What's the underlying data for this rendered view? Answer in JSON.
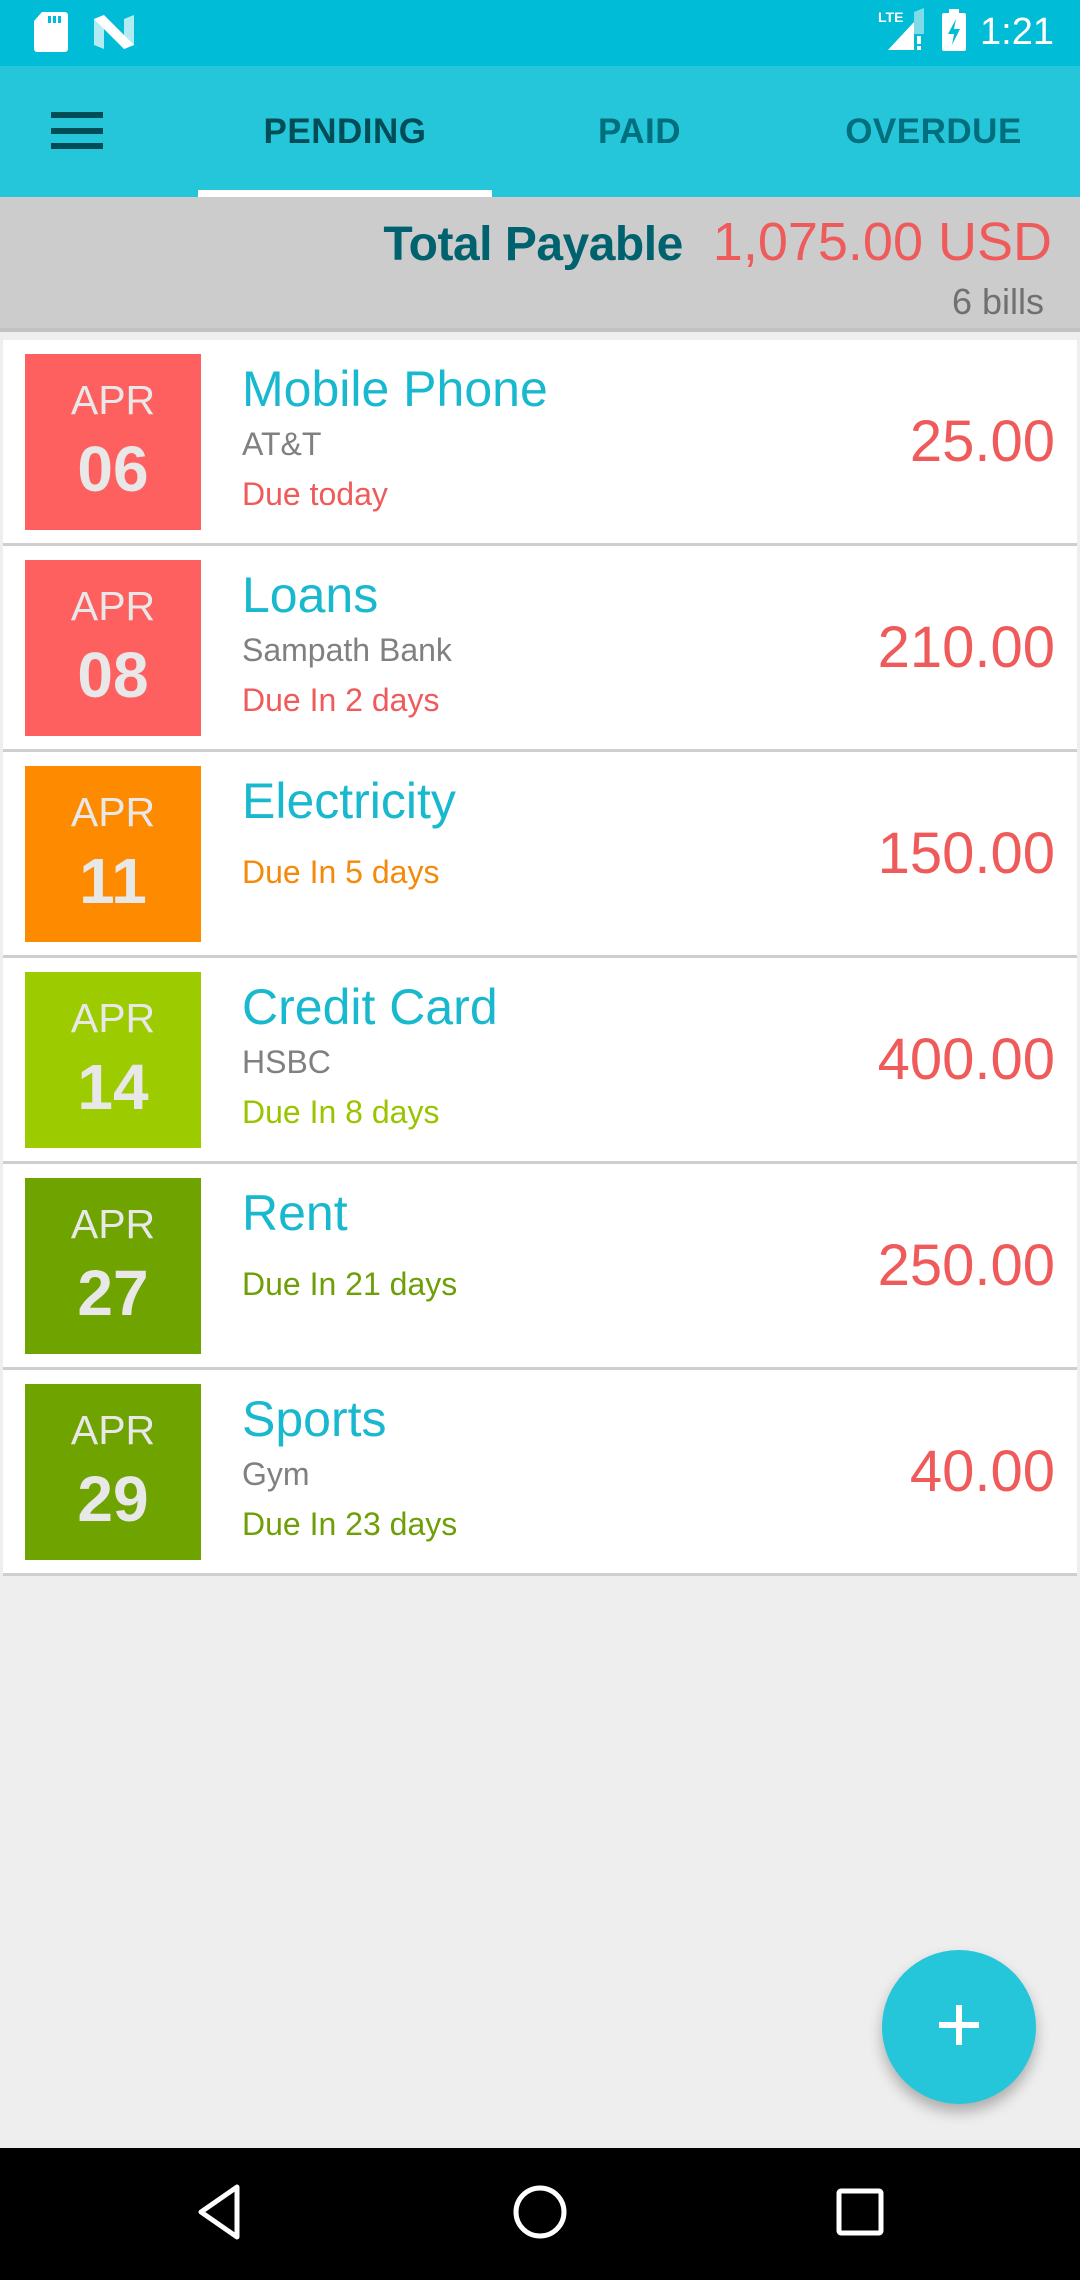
{
  "status_bar": {
    "time": "1:21",
    "icons": [
      "sd-card-icon",
      "android-n-icon",
      "lte-signal-icon",
      "battery-charging-icon"
    ],
    "network_label": "LTE"
  },
  "toolbar": {
    "menu_icon": "hamburger-menu-icon",
    "tabs": [
      {
        "label": "PENDING",
        "active": true
      },
      {
        "label": "PAID",
        "active": false
      },
      {
        "label": "OVERDUE",
        "active": false
      }
    ]
  },
  "summary": {
    "total_label": "Total Payable",
    "total_value": "1,075.00 USD",
    "bill_count": "6 bills"
  },
  "bills": [
    {
      "month": "APR",
      "day": "06",
      "name": "Mobile Phone",
      "payee": "AT&T",
      "due": "Due today",
      "amount": "25.00",
      "color": "#fe6060",
      "due_color": "#ef5a5a"
    },
    {
      "month": "APR",
      "day": "08",
      "name": "Loans",
      "payee": "Sampath Bank",
      "due": "Due In 2 days",
      "amount": "210.00",
      "color": "#fe6060",
      "due_color": "#ef5a5a"
    },
    {
      "month": "APR",
      "day": "11",
      "name": "Electricity",
      "payee": "",
      "due": "Due In 5 days",
      "amount": "150.00",
      "color": "#fe8a00",
      "due_color": "#f58a0a"
    },
    {
      "month": "APR",
      "day": "14",
      "name": "Credit Card",
      "payee": "HSBC",
      "due": "Due In 8 days",
      "amount": "400.00",
      "color": "#9ccc00",
      "due_color": "#9ac400"
    },
    {
      "month": "APR",
      "day": "27",
      "name": "Rent",
      "payee": "",
      "due": "Due In 21 days",
      "amount": "250.00",
      "color": "#6ea300",
      "due_color": "#6e9e08"
    },
    {
      "month": "APR",
      "day": "29",
      "name": "Sports",
      "payee": "Gym",
      "due": "Due In 23 days",
      "amount": "40.00",
      "color": "#6ea300",
      "due_color": "#6e9e08"
    }
  ],
  "fab": {
    "icon": "plus-icon",
    "label": "Add bill"
  },
  "nav_bar": {
    "buttons": [
      "back",
      "home",
      "recents"
    ]
  },
  "colors": {
    "status_bar": "#00bcd6",
    "toolbar": "#26c6da",
    "accent_red": "#ef5a5a",
    "title_teal": "#00626f",
    "bill_name": "#18b8cf"
  }
}
